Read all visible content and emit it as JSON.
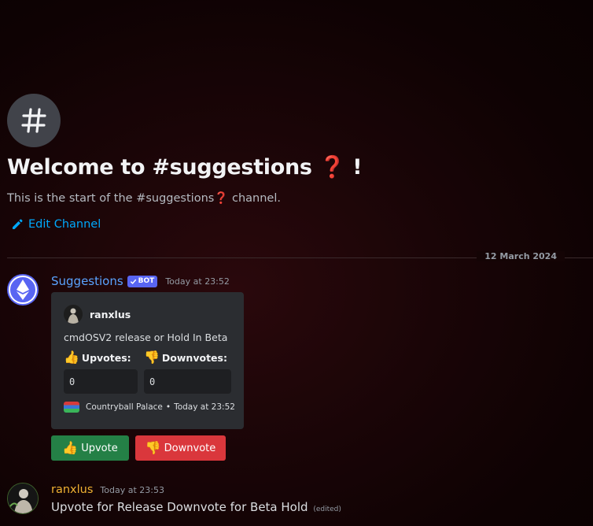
{
  "channel": {
    "icon": "hash-icon",
    "welcome_title_prefix": "Welcome to #suggestions",
    "welcome_title_emoji": "❓",
    "welcome_title_suffix": "!",
    "start_text_prefix": "This is the start of the #suggestions",
    "start_text_emoji": "❓",
    "start_text_suffix": "channel.",
    "edit_label": "Edit Channel"
  },
  "divider_date": "12 March 2024",
  "bot_message": {
    "username": "Suggestions",
    "tag": "BOT",
    "timestamp": "Today at 23:52",
    "embed": {
      "author": "ranxlus",
      "description": "cmdOSV2 release or Hold In Beta",
      "upvotes_label": "Upvotes:",
      "downvotes_label": "Downvotes:",
      "upvotes_value": "0",
      "downvotes_value": "0",
      "footer_server": "Countryball Palace",
      "footer_sep": "•",
      "footer_time": "Today at 23:52"
    },
    "buttons": {
      "upvote_label": "Upvote",
      "downvote_label": "Downvote"
    }
  },
  "user_message": {
    "username": "ranxlus",
    "timestamp": "Today at 23:53",
    "text": "Upvote for Release Downvote for Beta Hold",
    "edited": "(edited)"
  },
  "colors": {
    "accent": "#00a8fc",
    "bot_name": "#5aa3ff",
    "user_name": "#f0b232",
    "upvote_btn": "#248046",
    "downvote_btn": "#da373c",
    "embed_bg": "#2b2d31"
  }
}
